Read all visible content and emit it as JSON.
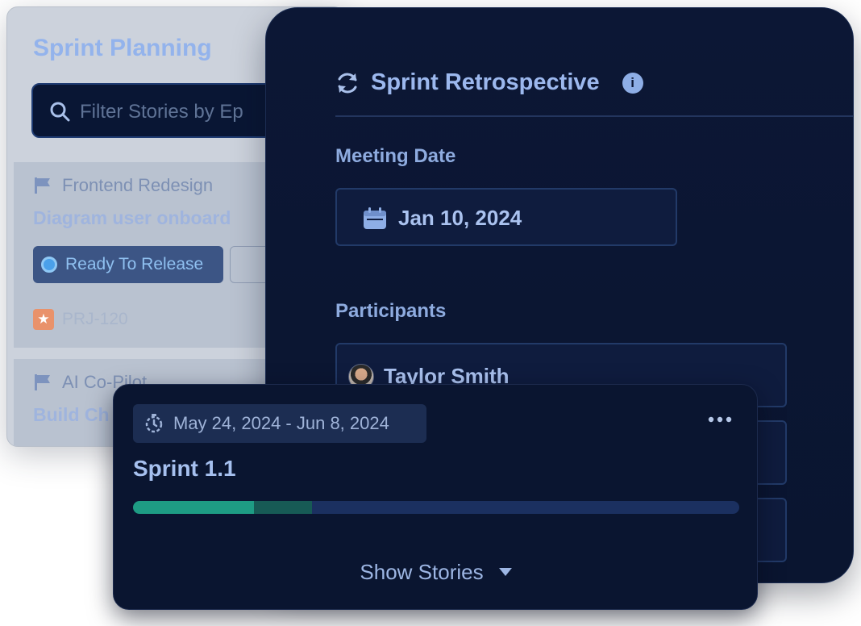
{
  "planning": {
    "title": "Sprint Planning",
    "search_placeholder": "Filter Stories by Ep",
    "stories": [
      {
        "epic": "Frontend Redesign",
        "name": "Diagram user onboard",
        "status": "Ready To Release",
        "id": "PRJ-120"
      },
      {
        "epic": "AI Co-Pilot",
        "name": "Build Ch"
      }
    ]
  },
  "retrospective": {
    "title": "Sprint Retrospective",
    "meeting_date_label": "Meeting Date",
    "meeting_date_value": "Jan 10, 2024",
    "participants_label": "Participants",
    "participants": [
      "Taylor Smith",
      "",
      ""
    ]
  },
  "sprint": {
    "date_range": "May 24, 2024 - Jun 8, 2024",
    "name": "Sprint 1.1",
    "progress": {
      "completed": 0.2,
      "in_progress": 0.095
    },
    "show_stories_label": "Show Stories"
  },
  "colors": {
    "progress_completed": "#1e9c84",
    "progress_in_progress": "#175a55",
    "status_ready": "#3c5585",
    "accent_text": "#9cb8ee"
  }
}
